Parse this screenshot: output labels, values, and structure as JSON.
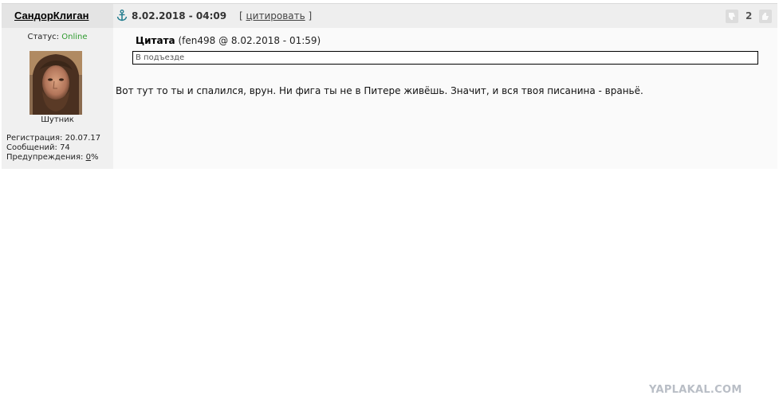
{
  "post": {
    "author": {
      "name": "СандорКлиган",
      "status_label": "Статус:",
      "status_value": "Online",
      "rank": "Шутник",
      "registration_label": "Регистрация:",
      "registration_date": "20.07.17",
      "messages_label": "Сообщений:",
      "messages_count": "74",
      "warnings_label": "Предупреждения:",
      "warnings_value": "0",
      "warnings_suffix": "%"
    },
    "header": {
      "anchor_icon": "anchor-icon",
      "date": "8.02.2018 - 04:09",
      "quote_open": "[",
      "quote_link": "цитировать",
      "quote_close": "]",
      "rating": "2"
    },
    "quote": {
      "title": "Цитата",
      "meta": "(fen498 @ 8.02.2018 - 01:59)",
      "text": "В подъезде"
    },
    "body": "Вот тут то ты и спалился, врун. Ни фига ты не в Питере живёшь. Значит, и вся твоя писанина - враньё."
  },
  "watermark": "YAPLAKAL.COM",
  "colors": {
    "online": "#2f9a2f",
    "header_bg": "#eeeeee",
    "sidebar_bg": "#f0f0f0",
    "watermark": "#b9bec6"
  }
}
